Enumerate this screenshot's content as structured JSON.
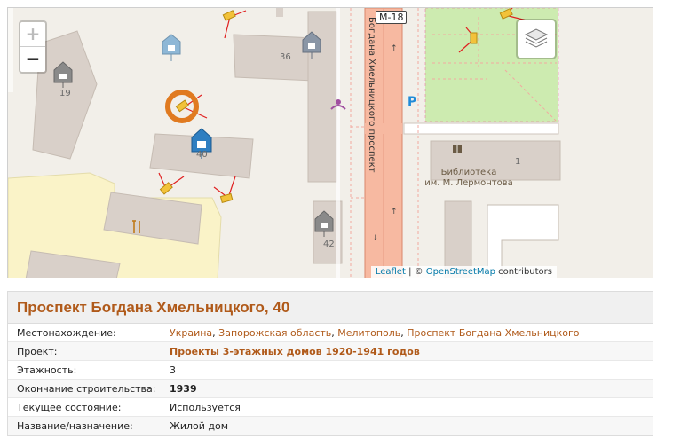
{
  "map": {
    "house_numbers": [
      "19",
      "36",
      "40",
      "42",
      "1"
    ],
    "road_name": "Проспект Богдана Хмельницкого",
    "road_label": "Богдана Хмельницкого проспект",
    "highway_shield": "М-18",
    "library_label_line1": "Библиотека",
    "library_label_line2": "им. М. Лермонтова",
    "parking_label": "P",
    "zoom_in": "+",
    "zoom_out": "−",
    "attribution": {
      "leaflet": "Leaflet",
      "sep": " | © ",
      "osm": "OpenStreetMap",
      "tail": " contributors"
    },
    "colors": {
      "background": "#f2efe9",
      "building": "#d9d0c9",
      "main_road": "#f7b9a1",
      "park": "#cdebb0",
      "residential": "#faf3c8",
      "marker_blue": "#2f7fc1",
      "marker_grey": "#8a8a8a",
      "camera": "#f2c23a",
      "camera_ray": "#e02020",
      "selected_ring": "#e07a20"
    }
  },
  "info": {
    "title": "Проспект Богдана Хмельницкого, 40",
    "location": {
      "label": "Местонахождение:",
      "links": [
        "Украина",
        "Запорожская область",
        "Мелитополь",
        "Проспект Богдана Хмельницкого"
      ]
    },
    "project": {
      "label": "Проект:",
      "value": "Проекты 3-этажных домов 1920-1941 годов"
    },
    "floors": {
      "label": "Этажность:",
      "value": "3"
    },
    "built": {
      "label": "Окончание строительства:",
      "value": "1939"
    },
    "state": {
      "label": "Текущее состояние:",
      "value": "Используется"
    },
    "purpose": {
      "label": "Название/назначение:",
      "value": "Жилой дом"
    }
  }
}
